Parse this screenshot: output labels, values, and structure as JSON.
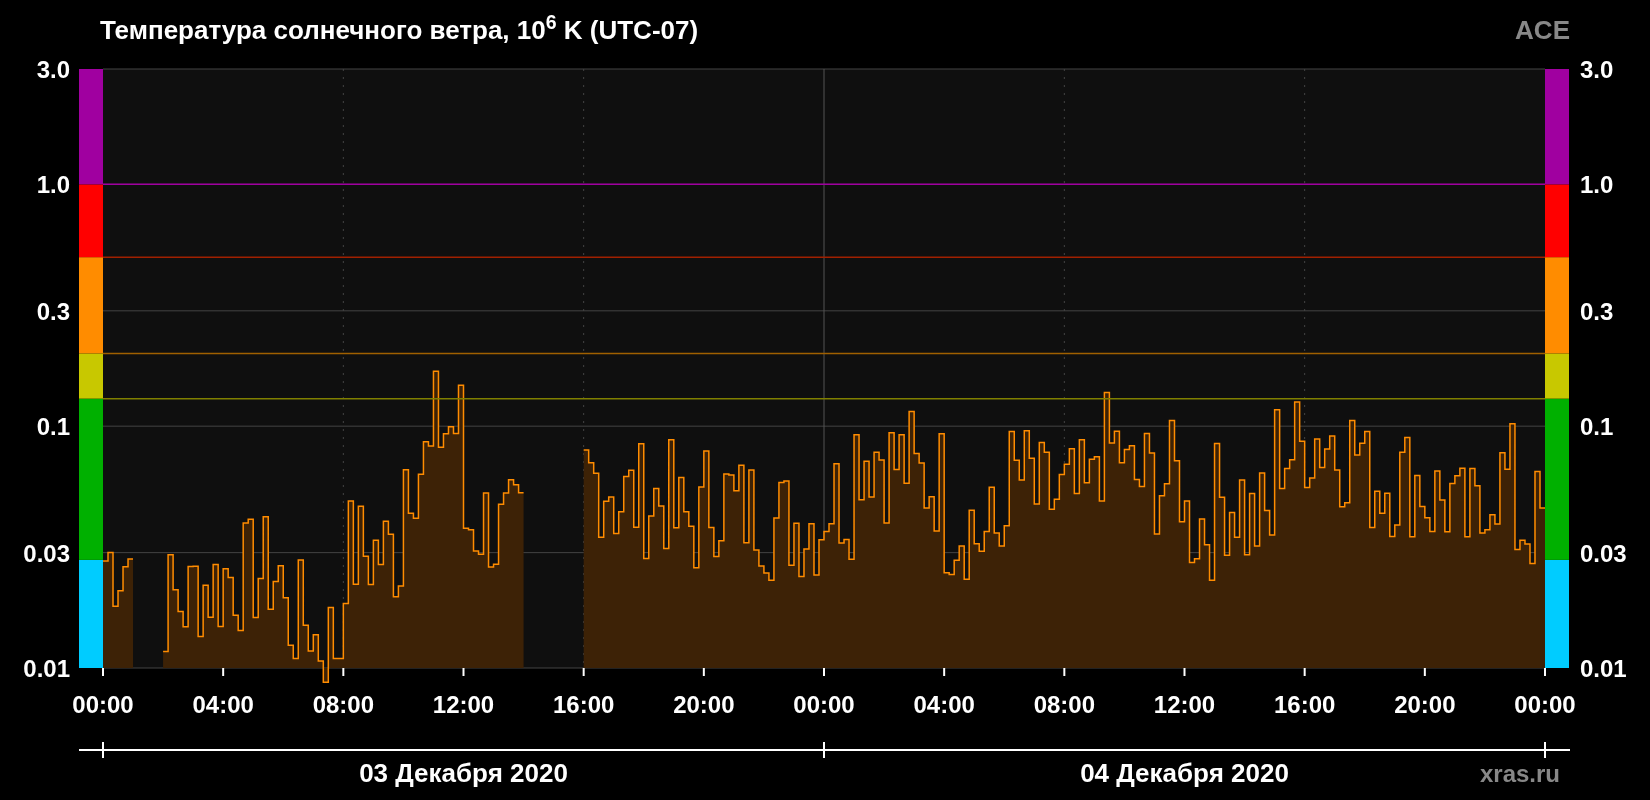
{
  "title": "Температура солнечного ветра, 10$^{6}$ K (UTC-07)",
  "source": "ACE",
  "left_axis_labels": [
    "3.0",
    "1.0",
    "0.3",
    "0.1",
    "0.03",
    "0.01"
  ],
  "right_axis_labels": [
    "3.0",
    "1.0",
    "0.3",
    "0.1",
    "0.03",
    "0.01"
  ],
  "x_axis_labels": [
    "00:00",
    "04:00",
    "08:00",
    "12:00",
    "16:00",
    "20:00",
    "00:00",
    "04:00",
    "08:00",
    "12:00",
    "16:00",
    "20:00",
    "00:00"
  ],
  "days": [
    {
      "label": "03 Декабря 2020"
    },
    {
      "label": "04 Декабря 2020"
    }
  ],
  "credit": "xras.ru"
}
